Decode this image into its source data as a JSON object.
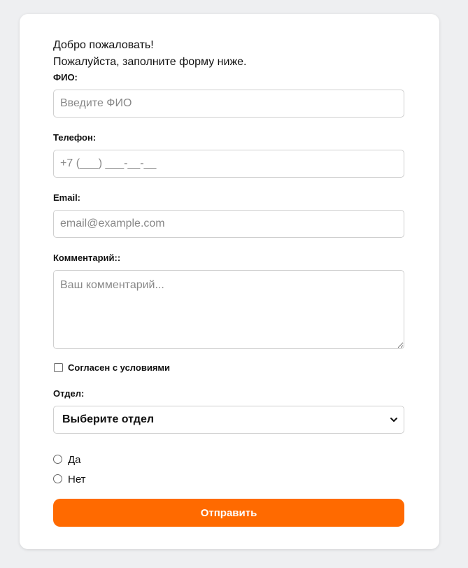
{
  "header": {
    "welcome": "Добро пожаловать!",
    "subtitle": "Пожалуйста, заполните форму ниже."
  },
  "form": {
    "name": {
      "label": "ФИО:",
      "placeholder": "Введите ФИО",
      "value": ""
    },
    "phone": {
      "label": "Телефон:",
      "placeholder": "+7 (___) ___-__-__",
      "value": ""
    },
    "email": {
      "label": "Email:",
      "placeholder": "email@example.com",
      "value": ""
    },
    "comment": {
      "label": "Комментарий::",
      "placeholder": "Ваш комментарий...",
      "value": ""
    },
    "agree": {
      "label": "Согласен с условиями",
      "checked": false
    },
    "department": {
      "label": "Отдел:",
      "selected": "Выберите отдел"
    },
    "radio_options": [
      {
        "label": "Да",
        "checked": false
      },
      {
        "label": "Нет",
        "checked": false
      }
    ],
    "submit_label": "Отправить"
  },
  "colors": {
    "accent": "#ff6a00",
    "page_background": "#eeeff1",
    "card_background": "#ffffff",
    "border": "#cfcfcf"
  },
  "icons": {
    "select_arrow": "chevron-down-icon"
  }
}
